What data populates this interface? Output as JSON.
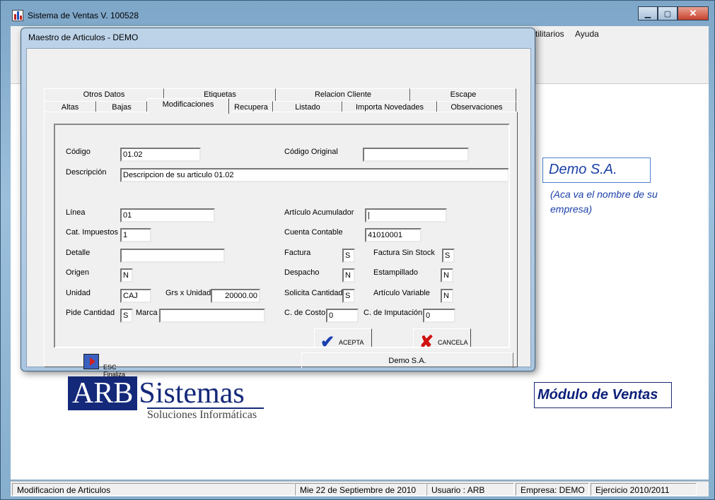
{
  "main": {
    "title": "Sistema de Ventas V. 100528",
    "menu": {
      "utilitarios": "tilitarios",
      "ayuda": "Ayuda"
    }
  },
  "brand": {
    "company": "Demo S.A.",
    "note": "(Aca va el nombre de su empresa)",
    "module": "Módulo de Ventas"
  },
  "logo": {
    "arb": "ARB",
    "sistemas": "Sistemas",
    "sub": "Soluciones Informáticas"
  },
  "status": {
    "mode": "Modificacion de Articulos",
    "date": "Mie 22 de Septiembre de 2010",
    "user": "Usuario : ARB",
    "empresa": "Empresa: DEMO",
    "ejercicio": "Ejercicio 2010/2011"
  },
  "dialog": {
    "title": "Maestro de Articulos  - DEMO",
    "tabs_back": [
      "Otros Datos",
      "Etiquetas",
      "Relacion Cliente",
      "Escape"
    ],
    "tabs_front": [
      "Altas",
      "Bajas",
      "Modificaciones",
      "Recupera",
      "Listado",
      "Importa Novedades",
      "Observaciones"
    ],
    "active_tab": "Modificaciones",
    "labels": {
      "codigo": "Código",
      "codigo_original": "Código Original",
      "descripcion": "Descripción",
      "linea": "Línea",
      "articulo_acumulador": "Artículo Acumulador",
      "cat_impuestos": "Cat. Impuestos",
      "cuenta_contable": "Cuenta Contable",
      "detalle": "Detalle",
      "factura": "Factura",
      "factura_sin_stock": "Factura Sin Stock",
      "origen": "Origen",
      "despacho": "Despacho",
      "estampillado": "Estampillado",
      "unidad": "Unidad",
      "grs_x_unidad": "Grs x Unidad",
      "solicita_cantidad": "Solicita Cantidad",
      "articulo_variable": "Artículo Variable",
      "pide_cantidad": "Pide Cantidad",
      "marca": "Marca",
      "c_costo": "C. de Costo",
      "c_imputacion": "C. de Imputación"
    },
    "values": {
      "codigo": "01.02",
      "codigo_original": "",
      "descripcion": "Descripcion de su articulo 01.02",
      "linea": "01",
      "articulo_acumulador": "|",
      "cat_impuestos": "1",
      "cuenta_contable": "41010001",
      "detalle": "",
      "factura": "S",
      "factura_sin_stock": "S",
      "origen": "N",
      "despacho": "N",
      "estampillado": "N",
      "unidad": "CAJ",
      "grs_x_unidad": "20000.00",
      "solicita_cantidad": "S",
      "articulo_variable": "N",
      "pide_cantidad": "S",
      "marca": "",
      "c_costo": "0",
      "c_imputacion": "0"
    },
    "buttons": {
      "acepta": "ACEPTA",
      "cancela": "CANCELA",
      "esc": "ESC Finaliza"
    },
    "footer_company": "Demo S.A."
  }
}
